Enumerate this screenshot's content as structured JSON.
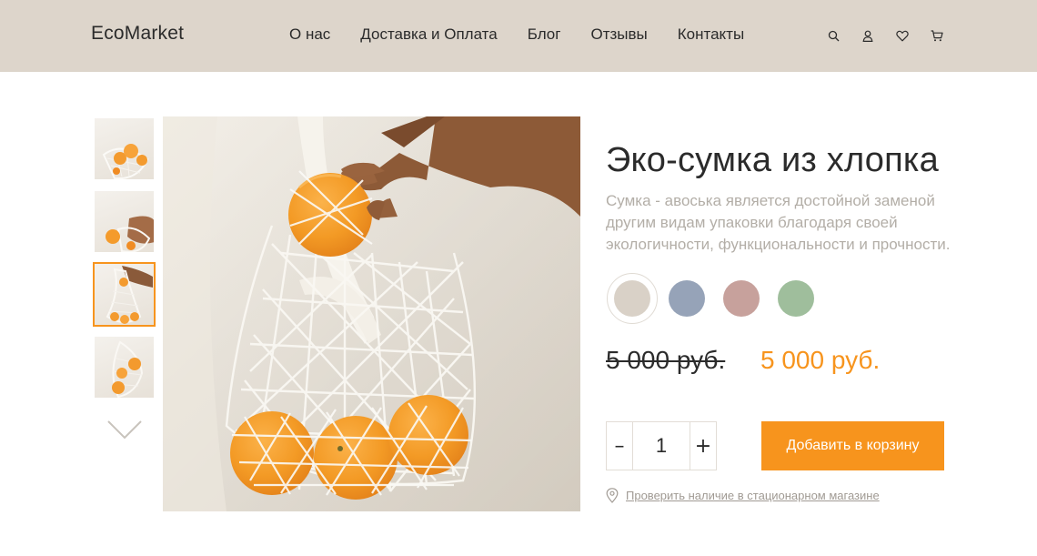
{
  "header": {
    "logo": "EcoMarket",
    "nav": [
      "О нас",
      "Доставка и Оплата",
      "Блог",
      "Отзывы",
      "Контакты"
    ],
    "icons": [
      "search-icon",
      "user-icon",
      "heart-icon",
      "cart-icon"
    ]
  },
  "gallery": {
    "thumbnail_count": 4,
    "active_thumbnail": 3,
    "next_icon": "chevron-down-icon"
  },
  "product": {
    "title": "Эко-сумка из хлопка",
    "description": "Сумка - авоська является достойной заменой другим видам упаковки благодаря своей экологичности, функциональности и прочности.",
    "colors": [
      "#d9d1c7",
      "#96a3b8",
      "#c7a19c",
      "#9fbe9c"
    ],
    "selected_color": 0,
    "price_old": "5 000 руб.",
    "price_new": "5 000 руб.",
    "quantity": "1",
    "minus_label": "–",
    "plus_label": "+",
    "add_to_cart": "Добавить в корзину",
    "store_check": "Проверить наличие в стационарном магазине",
    "store_icon": "location-pin-icon"
  },
  "colors": {
    "accent": "#f7941d",
    "header_bg": "#ddd5cb"
  }
}
